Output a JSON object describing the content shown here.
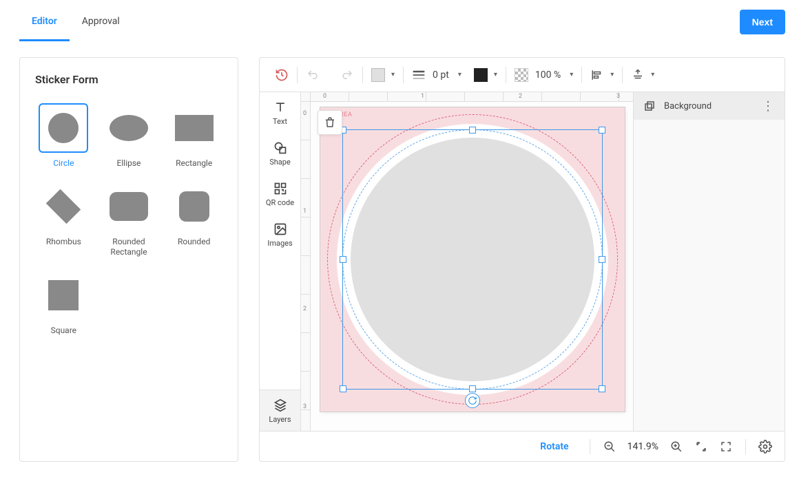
{
  "header": {
    "tabs": [
      {
        "id": "editor",
        "label": "Editor",
        "active": true
      },
      {
        "id": "approval",
        "label": "Approval",
        "active": false
      }
    ],
    "next_label": "Next"
  },
  "left_panel": {
    "title": "Sticker Form",
    "shapes": [
      {
        "id": "circle",
        "label": "Circle",
        "selected": true
      },
      {
        "id": "ellipse",
        "label": "Ellipse"
      },
      {
        "id": "rectangle",
        "label": "Rectangle"
      },
      {
        "id": "rhombus",
        "label": "Rhombus"
      },
      {
        "id": "rounded_rectangle",
        "label": "Rounded Rectangle"
      },
      {
        "id": "rounded",
        "label": "Rounded"
      },
      {
        "id": "square",
        "label": "Square"
      }
    ]
  },
  "side_tools": {
    "text": "Text",
    "shape": "Shape",
    "qr_code": "QR code",
    "images": "Images",
    "layers": "Layers"
  },
  "toolbar": {
    "fill_color": "#e0e0e0",
    "stroke_weight_text": "0 pt",
    "stroke_color": "#222222",
    "opacity_text": "100 %"
  },
  "canvas": {
    "safe_area_label": "AREA",
    "ruler_marks": [
      "0",
      "1",
      "2",
      "3"
    ]
  },
  "layers_panel": {
    "items": [
      {
        "name": "Background"
      }
    ]
  },
  "bottom_bar": {
    "rotate_label": "Rotate",
    "zoom_text": "141.9%"
  }
}
